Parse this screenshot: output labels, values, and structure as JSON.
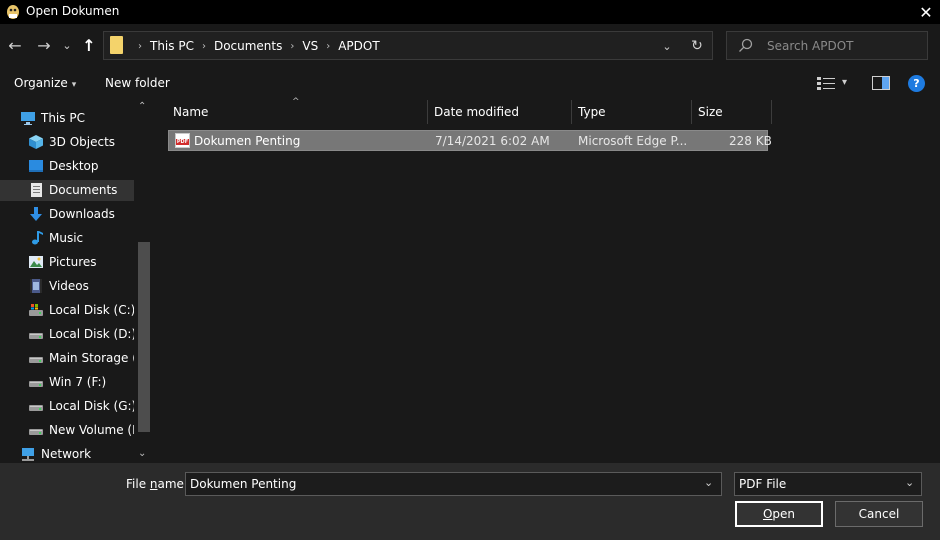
{
  "window": {
    "title": "Open Dokumen",
    "close_glyph": "✕"
  },
  "nav": {
    "back_glyph": "←",
    "forward_glyph": "→",
    "recent_glyph": "⌄",
    "up_glyph": "↑",
    "address": {
      "crumbs": [
        "This PC",
        "Documents",
        "VS",
        "APDOT"
      ],
      "separator": "›",
      "dropdown_glyph": "⌄",
      "refresh_glyph": "↻"
    },
    "search": {
      "placeholder": "Search APDOT"
    }
  },
  "toolbar": {
    "organize_label": "Organize",
    "caret": "▾",
    "new_folder_label": "New folder",
    "view_caret": "▾",
    "help_label": "?"
  },
  "sidebar": {
    "scroll_up_glyph": "⌃",
    "scroll_down_glyph": "⌄",
    "items": [
      {
        "label": "This PC",
        "icon": "this-pc-icon",
        "level": 0
      },
      {
        "label": "3D Objects",
        "icon": "3d-objects-icon",
        "level": 1
      },
      {
        "label": "Desktop",
        "icon": "desktop-icon",
        "level": 1
      },
      {
        "label": "Documents",
        "icon": "documents-icon",
        "level": 1,
        "selected": true
      },
      {
        "label": "Downloads",
        "icon": "downloads-icon",
        "level": 1
      },
      {
        "label": "Music",
        "icon": "music-icon",
        "level": 1
      },
      {
        "label": "Pictures",
        "icon": "pictures-icon",
        "level": 1
      },
      {
        "label": "Videos",
        "icon": "videos-icon",
        "level": 1
      },
      {
        "label": "Local Disk (C:)",
        "icon": "system-drive-icon",
        "level": 1
      },
      {
        "label": "Local Disk (D:)",
        "icon": "drive-icon",
        "level": 1
      },
      {
        "label": "Main Storage (E:",
        "icon": "drive-icon",
        "level": 1
      },
      {
        "label": "Win 7 (F:)",
        "icon": "drive-icon",
        "level": 1
      },
      {
        "label": "Local Disk (G:)",
        "icon": "drive-icon",
        "level": 1
      },
      {
        "label": "New Volume (H:",
        "icon": "drive-icon",
        "level": 1
      },
      {
        "label": "Network",
        "icon": "network-icon",
        "level": 0
      }
    ]
  },
  "file_list": {
    "sort_glyph": "^",
    "columns": {
      "name": "Name",
      "date": "Date modified",
      "type": "Type",
      "size": "Size"
    },
    "rows": [
      {
        "name": "Dokumen Penting",
        "date": "7/14/2021 6:02 AM",
        "type": "Microsoft Edge P...",
        "size": "228 KB",
        "icon_text": "PDF"
      }
    ]
  },
  "footer": {
    "file_name_label_pre": "File ",
    "file_name_label_accel": "n",
    "file_name_label_post": "ame:",
    "file_name_value": "Dokumen Penting",
    "file_type_value": "PDF File",
    "dropdown_glyph": "⌄",
    "open_accel": "O",
    "open_rest": "pen",
    "cancel_label": "Cancel"
  },
  "colors": {
    "background": "#191919",
    "titlebar": "#000000",
    "selection": "#777777",
    "accent": "#1e7be0",
    "folder": "#f4d36b"
  }
}
